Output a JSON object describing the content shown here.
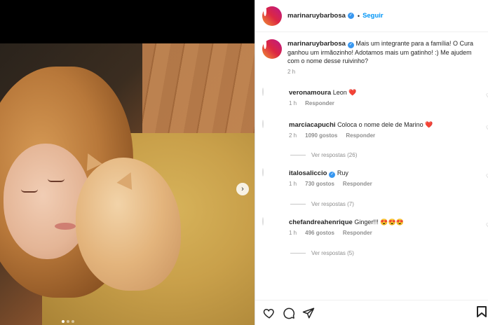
{
  "post": {
    "author": "marinaruybarbosa",
    "follow_label": "Seguir",
    "separator": "•",
    "caption": "Mais um integrante para a família! O Cura ganhou um irmãozinho! Adotamos mais um gatinho! :) Me ajudem com o nome desse ruivinho?",
    "caption_time": "2 h"
  },
  "comments": [
    {
      "user": "veronamoura",
      "text": "Leon ❤️",
      "time": "1 h",
      "likes": "",
      "reply_label": "Responder",
      "replies": ""
    },
    {
      "user": "marciacapuchi",
      "text": "Coloca o nome dele de Marino ❤️",
      "time": "2 h",
      "likes": "1090 gostos",
      "reply_label": "Responder",
      "replies": "Ver respostas (26)"
    },
    {
      "user": "italosaliccio",
      "text": "Ruy",
      "time": "1 h",
      "likes": "730 gostos",
      "reply_label": "Responder",
      "replies": "Ver respostas (7)",
      "verified": true
    },
    {
      "user": "chefandreahenrique",
      "text": "Ginger!!! 😍😍😍",
      "time": "1 h",
      "likes": "496 gostos",
      "reply_label": "Responder",
      "replies": "Ver respostas (5)"
    }
  ],
  "icons": {
    "verified": "verified-badge-icon",
    "next": "chevron-right-icon",
    "like": "heart-icon",
    "comment": "comment-icon",
    "share": "send-icon",
    "save": "bookmark-icon"
  },
  "colors": {
    "accent": "#0095f6",
    "verified": "#3897f0",
    "muted": "#8e8e8e",
    "heart": "#ed4956"
  },
  "carousel": {
    "count": 3,
    "active": 1
  }
}
